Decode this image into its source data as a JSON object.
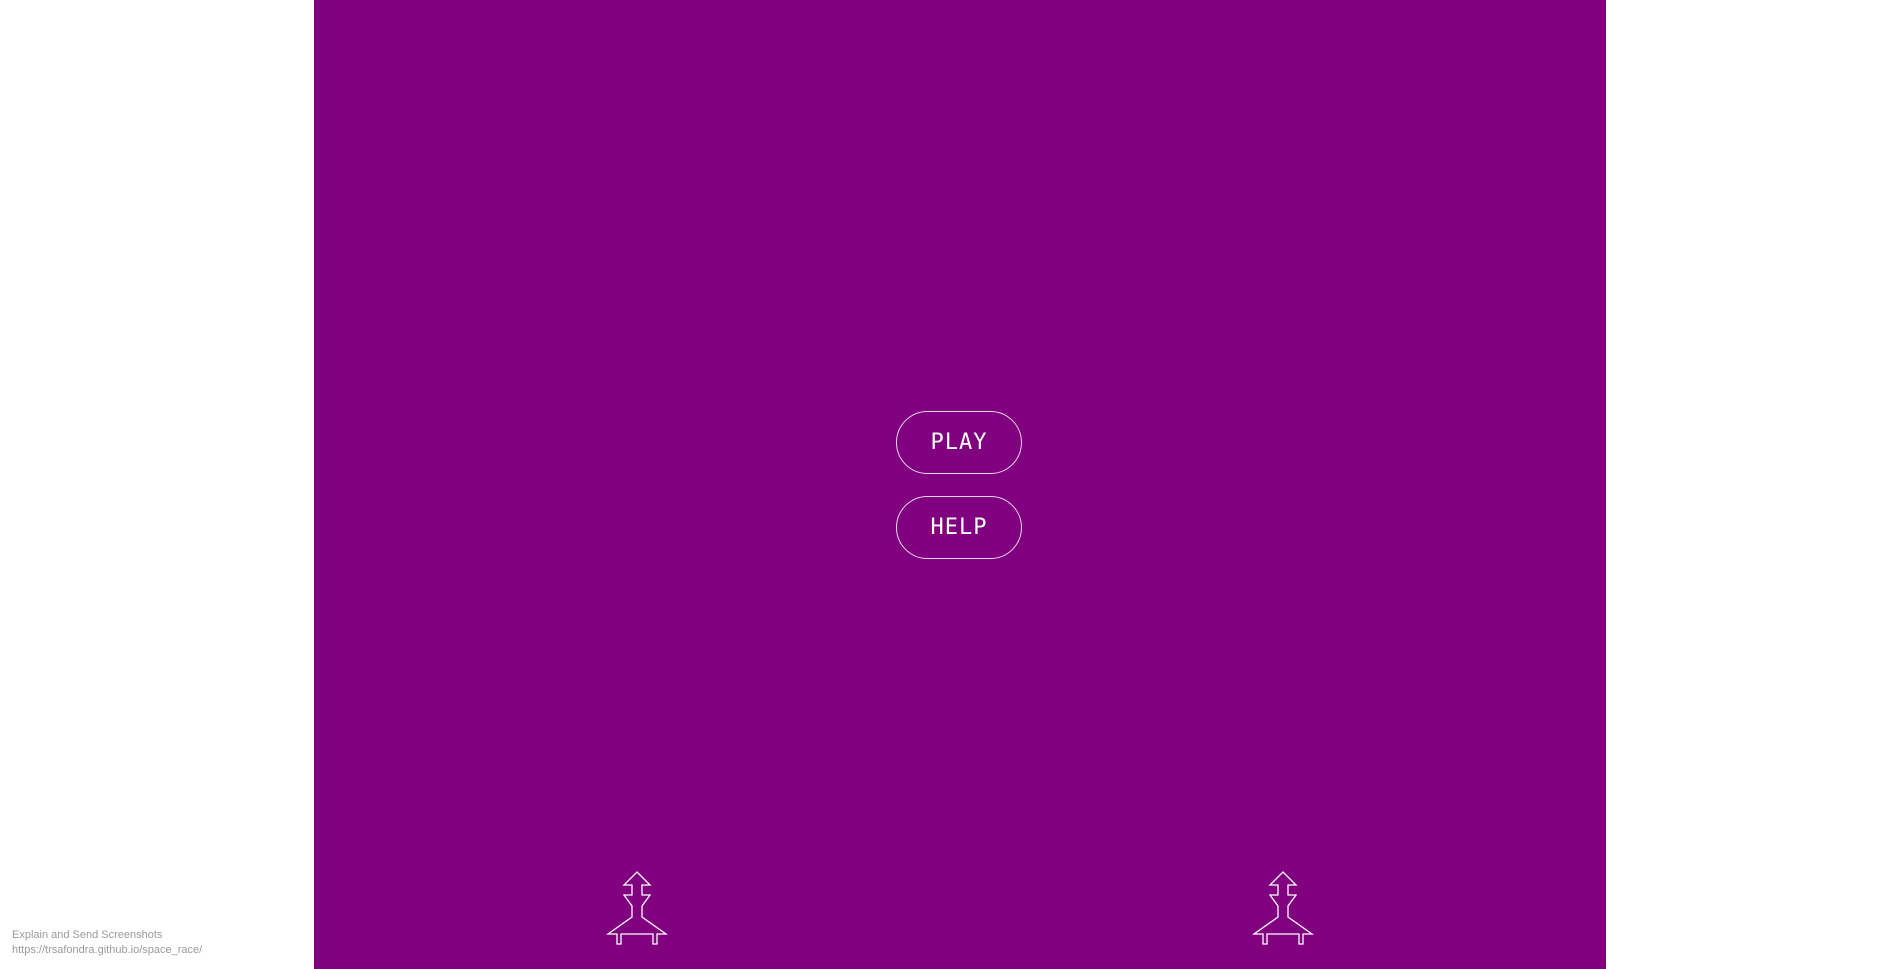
{
  "game": {
    "background_color": "#800080",
    "line_color": "#ffffff",
    "menu": {
      "play_label": "PLAY",
      "help_label": "HELP"
    },
    "players": [
      {
        "icon": "rocket-icon"
      },
      {
        "icon": "rocket-icon"
      }
    ]
  },
  "footer": {
    "line1": "Explain and Send Screenshots",
    "line2": "https://trsafondra.github.io/space_race/"
  }
}
